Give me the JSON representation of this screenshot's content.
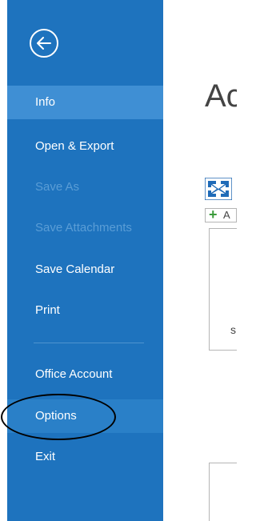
{
  "sidebar": {
    "items": [
      {
        "label": "Info",
        "state": "active"
      },
      {
        "label": "Open & Export",
        "state": "normal"
      },
      {
        "label": "Save As",
        "state": "disabled"
      },
      {
        "label": "Save Attachments",
        "state": "disabled"
      },
      {
        "label": "Save Calendar",
        "state": "normal"
      },
      {
        "label": "Print",
        "state": "normal"
      },
      {
        "label": "Office Account",
        "state": "normal"
      },
      {
        "label": "Options",
        "state": "hover"
      },
      {
        "label": "Exit",
        "state": "normal"
      }
    ],
    "back_icon": "back-arrow-icon"
  },
  "main": {
    "heading": "Ac",
    "add_label": "A",
    "card_text": "s"
  },
  "colors": {
    "sidebar": "#1e73be",
    "active": "#3f8fd4",
    "hover": "#2a80c8",
    "disabled_text": "#5a9dd6"
  }
}
